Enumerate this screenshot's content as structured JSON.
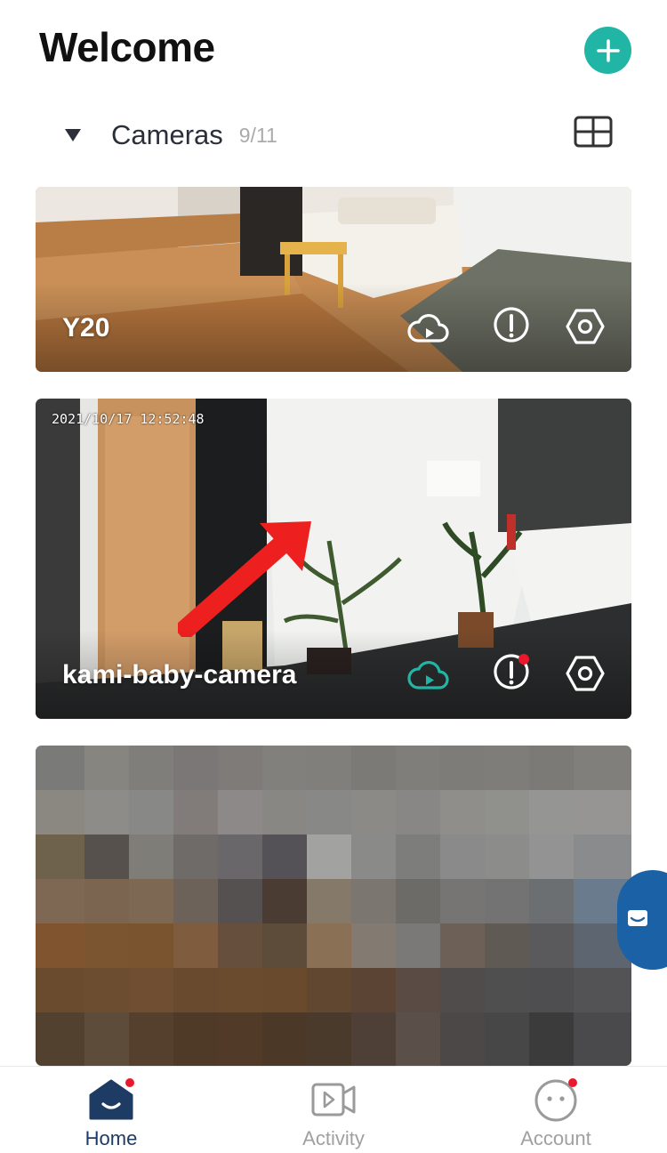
{
  "header": {
    "title": "Welcome",
    "add_icon": "plus-icon"
  },
  "section": {
    "label": "Cameras",
    "count": "9/11",
    "caret_icon": "caret-down-icon",
    "layout_icon": "grid-view-icon"
  },
  "cameras": [
    {
      "name": "Y20",
      "timestamp": "",
      "cloud_active": false,
      "alert_badge": false
    },
    {
      "name": "kami-baby-camera",
      "timestamp": "2021/10/17  12:52:48",
      "cloud_active": true,
      "alert_badge": true
    },
    {
      "name": "",
      "timestamp": "",
      "blurred": true
    }
  ],
  "tabs": [
    {
      "label": "Home",
      "icon": "home-icon",
      "active": true,
      "badge": true
    },
    {
      "label": "Activity",
      "icon": "video-icon",
      "active": false,
      "badge": false
    },
    {
      "label": "Account",
      "icon": "face-icon",
      "active": false,
      "badge": true
    }
  ],
  "colors": {
    "accent": "#21b5a6",
    "nav_active": "#1e3b63",
    "badge": "#e8192c",
    "chat": "#1a62a5",
    "arrow": "#ee1f1f"
  }
}
